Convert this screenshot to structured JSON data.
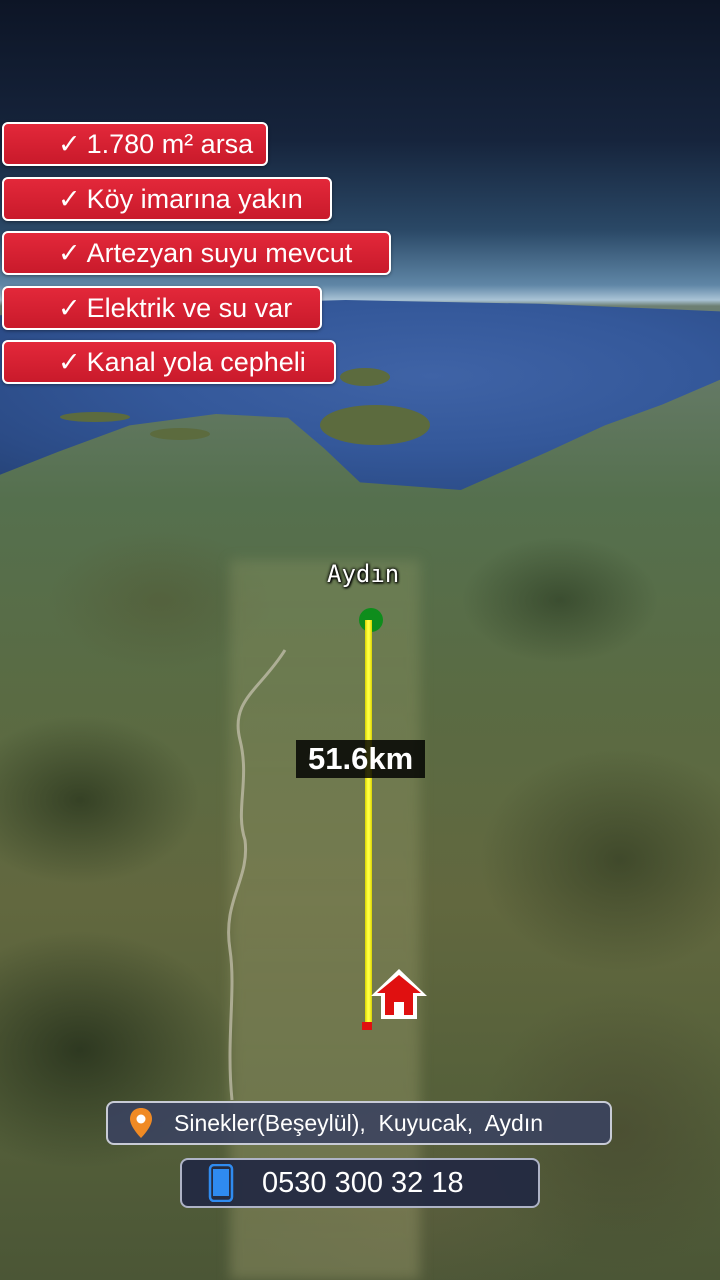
{
  "features": [
    {
      "check": "✓",
      "text": "1.780 m² arsa"
    },
    {
      "check": "✓",
      "text": "Köy imarına yakın"
    },
    {
      "check": "✓",
      "text": "Artezyan suyu mevcut"
    },
    {
      "check": "✓",
      "text": "Elektrik ve su var"
    },
    {
      "check": "✓",
      "text": "Kanal yola cepheli"
    }
  ],
  "map": {
    "city_label": "Aydın",
    "distance": "51.6km",
    "line_color": "#ffff40",
    "start_marker_color": "#0e8d1c",
    "home_marker_color": "#e01010"
  },
  "location": {
    "icon": "location-pin-icon",
    "text": "Sinekler(Beşeylül),  Kuyucak,  Aydın"
  },
  "contact": {
    "icon": "smartphone-icon",
    "phone": "0530 300 32 18"
  }
}
